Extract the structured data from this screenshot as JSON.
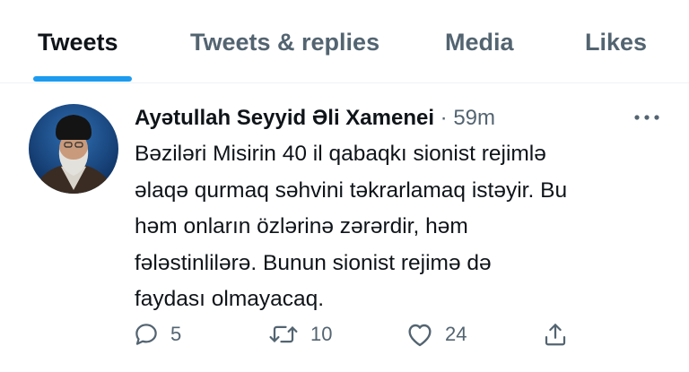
{
  "tabs": [
    {
      "label": "Tweets",
      "active": true
    },
    {
      "label": "Tweets & replies",
      "active": false
    },
    {
      "label": "Media",
      "active": false
    },
    {
      "label": "Likes",
      "active": false
    }
  ],
  "tweet": {
    "author_name": "Ayətullah Seyyid Əli Xamenei",
    "separator": " · ",
    "timestamp": "59m",
    "text": "Bəziləri Misirin 40 il qabaqkı sionist rejimlə\nəlaqə qurmaq səhvini təkrarlamaq istəyir. Bu\nhəm onların özlərinə zərərdir, həm\nfələstinlilərə. Bunun sionist rejimə də\nfaydası olmayacaq.",
    "actions": {
      "reply_count": "5",
      "retweet_count": "10",
      "like_count": "24"
    }
  },
  "colors": {
    "accent": "#1d9bf0",
    "text_primary": "#0f1419",
    "text_secondary": "#536471",
    "divider": "#eff3f4"
  },
  "icons": [
    "more-icon",
    "reply-icon",
    "retweet-icon",
    "like-icon",
    "share-icon"
  ]
}
